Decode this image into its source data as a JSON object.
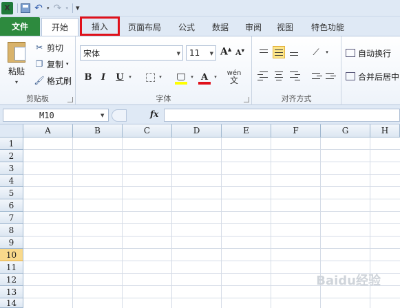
{
  "qat": {
    "excel_logo": "X",
    "undo": "↶",
    "redo": "↷",
    "customize": "▾"
  },
  "tabs": [
    {
      "label": "文件"
    },
    {
      "label": "开始"
    },
    {
      "label": "插入"
    },
    {
      "label": "页面布局"
    },
    {
      "label": "公式"
    },
    {
      "label": "数据"
    },
    {
      "label": "审阅"
    },
    {
      "label": "视图"
    },
    {
      "label": "特色功能"
    }
  ],
  "clipboard": {
    "paste_label": "粘贴",
    "cut_label": "剪切",
    "copy_label": "复制",
    "format_painter_label": "格式刷",
    "group_label": "剪贴板"
  },
  "font": {
    "font_name": "宋体",
    "font_size": "11",
    "bold": "B",
    "italic": "I",
    "underline": "U",
    "font_color_letter": "A",
    "phonetic_top": "wén",
    "phonetic_bottom": "文",
    "group_label": "字体"
  },
  "alignment": {
    "wrap_text_label": "自动换行",
    "merge_center_label": "合并后居中",
    "group_label": "对齐方式"
  },
  "formula_bar": {
    "name_box": "M10",
    "fx_label": "fx",
    "value": ""
  },
  "grid": {
    "columns": [
      "A",
      "B",
      "C",
      "D",
      "E",
      "F",
      "G",
      "H"
    ],
    "rows": [
      "1",
      "2",
      "3",
      "4",
      "5",
      "6",
      "7",
      "8",
      "9",
      "10",
      "11",
      "12",
      "13",
      "14"
    ],
    "active_row": "10"
  },
  "watermark": "Baidu经验"
}
